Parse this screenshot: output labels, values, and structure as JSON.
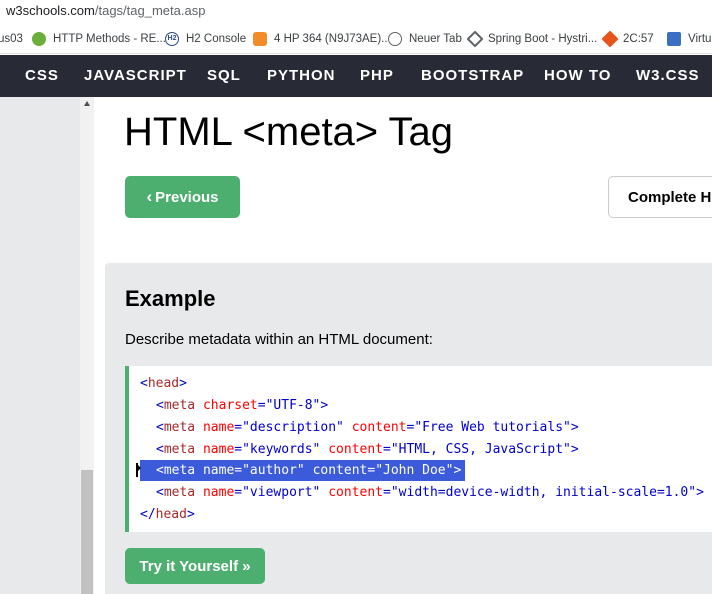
{
  "browser": {
    "url_host": "w3schools.com",
    "url_path": "/tags/tag_meta.asp",
    "bookmarks": [
      {
        "label": "us03",
        "icon": "none"
      },
      {
        "label": "HTTP Methods - RE...",
        "icon": "green-circle-icon"
      },
      {
        "label": "H2 Console",
        "icon": "h2-icon"
      },
      {
        "label": "4 HP 364 (N9J73AE)...",
        "icon": "hp-icon"
      },
      {
        "label": "Neuer Tab",
        "icon": "globe-icon"
      },
      {
        "label": "Spring Boot - Hystri...",
        "icon": "spring-icon"
      },
      {
        "label": "2C:57",
        "icon": "diamond-icon"
      },
      {
        "label": "Virtua",
        "icon": "virtualbox-icon"
      }
    ]
  },
  "topnav": {
    "items": [
      "CSS",
      "JAVASCRIPT",
      "SQL",
      "PYTHON",
      "PHP",
      "BOOTSTRAP",
      "HOW TO",
      "W3.CSS"
    ],
    "background": "#282a35"
  },
  "main": {
    "title": "HTML <meta> Tag",
    "prev_chevron": "‹",
    "prev_label": "Previous",
    "complete_label": "Complete H",
    "accent": "#4caf6f"
  },
  "example": {
    "title": "Example",
    "description": "Describe metadata within an HTML document:",
    "code": {
      "head_open": {
        "bracket_open": "<",
        "tag": "head",
        "bracket_close": ">"
      },
      "meta_charset": {
        "open": "<",
        "tag": "meta",
        "attr1": "charset",
        "eq1": "=",
        "val1": "\"UTF-8\"",
        "close": ">"
      },
      "meta_description": {
        "open": "<",
        "tag": "meta",
        "attr1": "name",
        "eq1": "=",
        "val1": "\"description\"",
        "attr2": "content",
        "eq2": "=",
        "val2": "\"Free Web tutorials\"",
        "close": ">"
      },
      "meta_keywords": {
        "open": "<",
        "tag": "meta",
        "attr1": "name",
        "eq1": "=",
        "val1": "\"keywords\"",
        "attr2": "content",
        "eq2": "=",
        "val2": "\"HTML, CSS, JavaScript\"",
        "close": ">"
      },
      "meta_author": {
        "open": "<",
        "tag": "meta",
        "attr1": "name",
        "eq1": "=",
        "val1": "\"author\"",
        "attr2": "content",
        "eq2": "=",
        "val2": "\"John Doe\"",
        "close": ">",
        "selected": true
      },
      "meta_viewport": {
        "open": "<",
        "tag": "meta",
        "attr1": "name",
        "eq1": "=",
        "val1": "\"viewport\"",
        "attr2": "content",
        "eq2": "=",
        "val2": "\"width=device-width, initial-scale=1.0\"",
        "close": ">"
      },
      "head_close": {
        "bracket_open": "</",
        "tag": "head",
        "bracket_close": ">"
      }
    },
    "try_label": "Try it Yourself »",
    "selection_color": "#3b5bdb"
  }
}
